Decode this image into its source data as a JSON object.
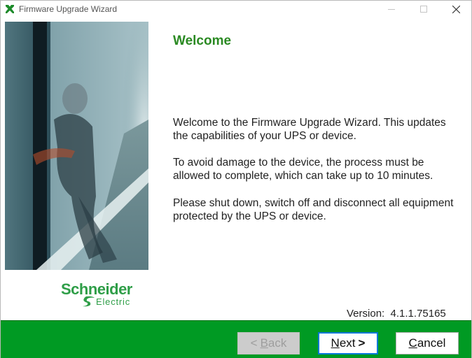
{
  "window": {
    "title": "Firmware Upgrade Wizard"
  },
  "branding": {
    "logo_name": "Schneider",
    "logo_sub": "Electric",
    "brand_color": "#009a23",
    "heading_color": "#2b8a23"
  },
  "page": {
    "heading": "Welcome",
    "paragraph1": "Welcome to the Firmware Upgrade Wizard. This updates the capabilities of your UPS or device.",
    "paragraph2": "To avoid damage to the device, the process must be allowed to complete, which can take up to 10 minutes.",
    "paragraph3": "Please shut down, switch off and disconnect all equipment protected by the UPS or device.",
    "version": "Version:  4.1.1.75165"
  },
  "buttons": {
    "back_prefix": "< ",
    "back_mnemonic": "B",
    "back_rest": "ack",
    "back_enabled": false,
    "next_mnemonic": "N",
    "next_rest": "ext",
    "next_suffix": ">",
    "cancel_mnemonic": "C",
    "cancel_rest": "ancel"
  }
}
